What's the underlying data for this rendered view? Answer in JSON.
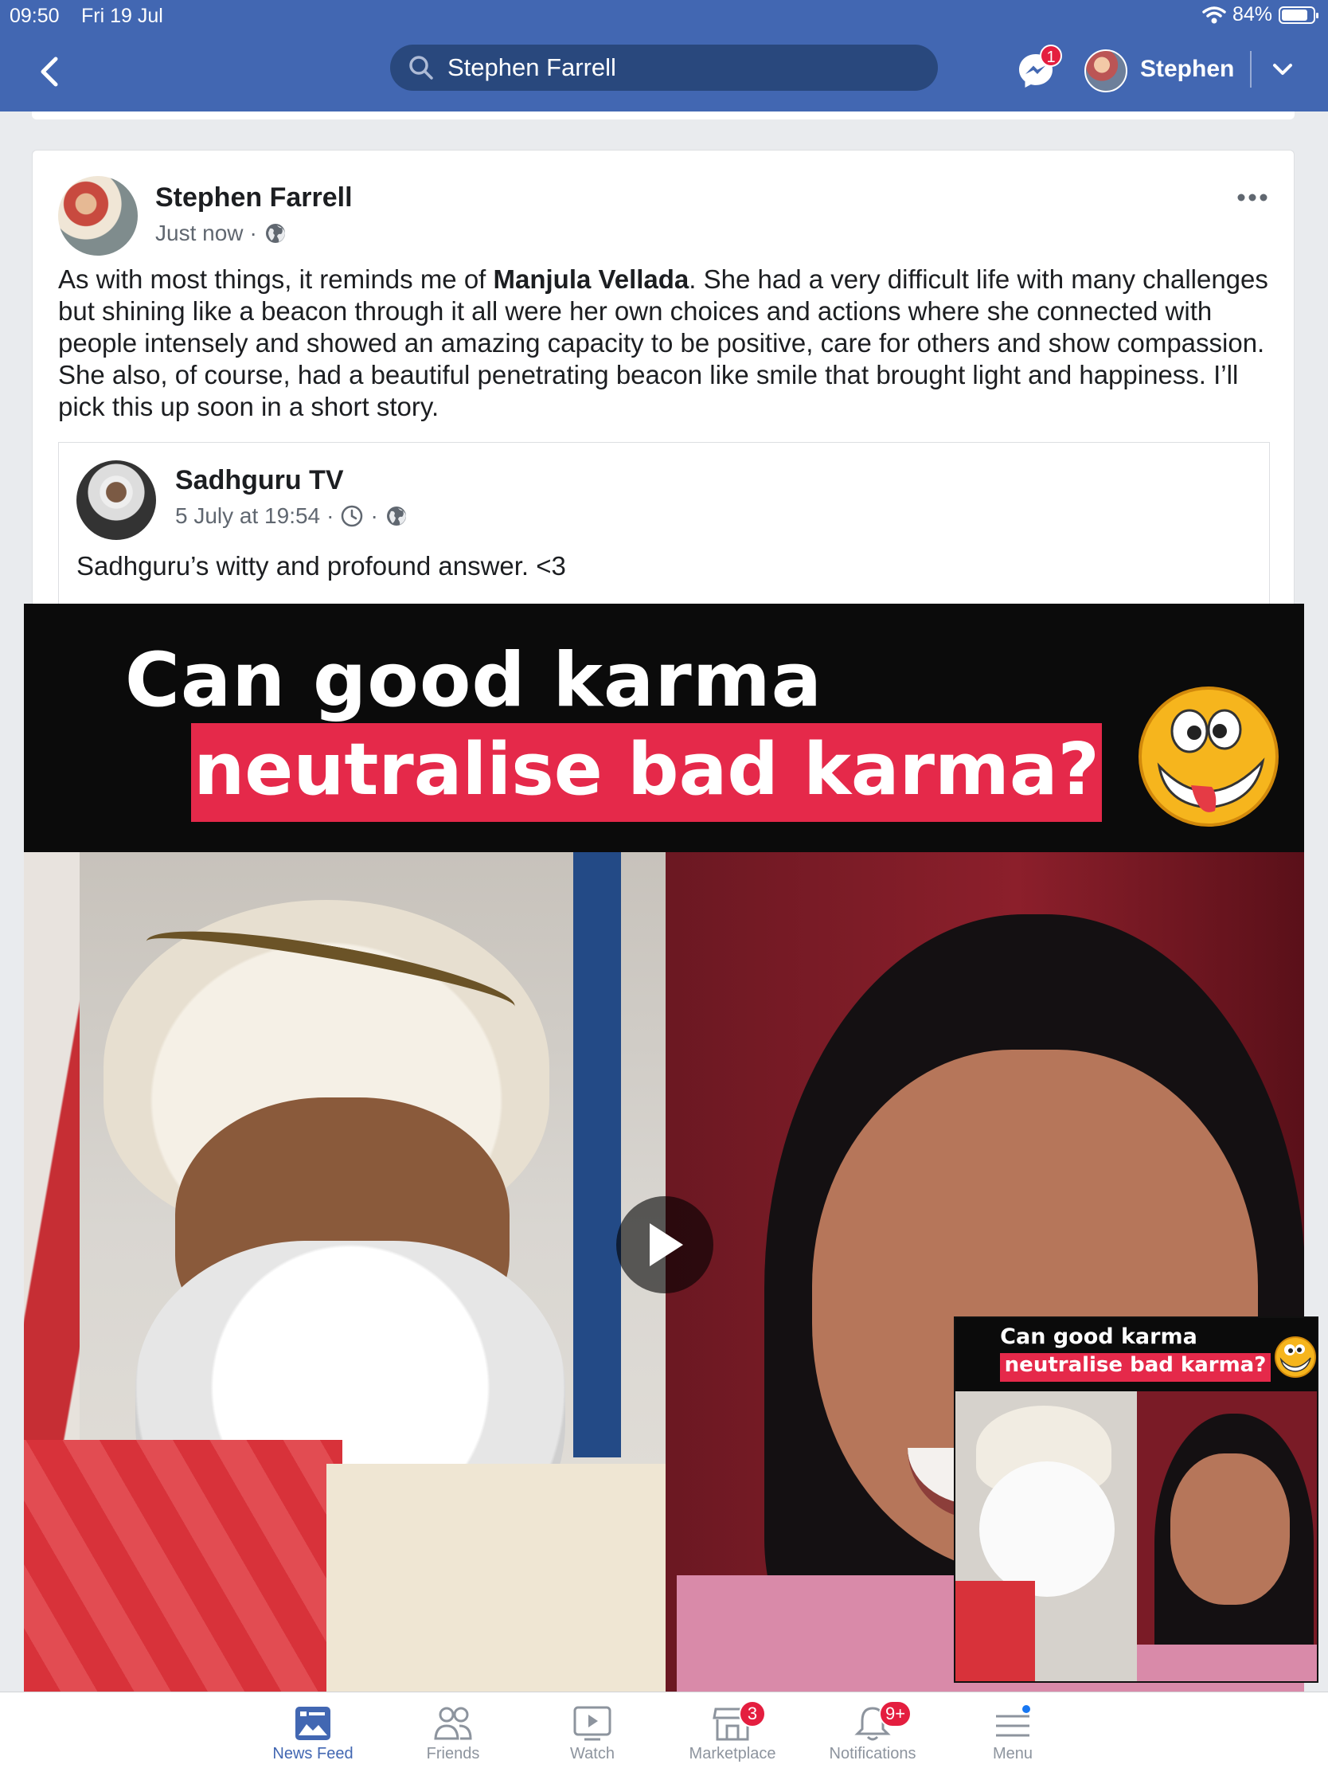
{
  "status_bar": {
    "time": "09:50",
    "date": "Fri 19 Jul",
    "battery": "84%",
    "battery_level": 0.84
  },
  "header": {
    "search_value": "Stephen Farrell",
    "messenger_badge": "1",
    "user_name": "Stephen"
  },
  "post": {
    "author": "Stephen Farrell",
    "time": "Just now",
    "text_before": "As with most things, it reminds me of ",
    "text_bold": "Manjula Vellada",
    "text_after": ". She had a very difficult life with many challenges but shining like a beacon through it all were her own choices and actions where she connected with people intensely and showed an amazing capacity to be positive, care for others and show compassion. She also, of course, had a beautiful penetrating beacon like smile that brought light and happiness. I’ll pick this up soon in a short story.",
    "shared": {
      "page_name": "Sadhguru TV",
      "time": "5 July at 19:54",
      "text": "Sadhguru’s witty and profound answer. <3",
      "video": {
        "title_line1": "Can good karma",
        "title_line2": "neutralise bad karma?"
      }
    }
  },
  "tabs": [
    {
      "label": "News Feed",
      "icon": "news-feed-icon",
      "active": true
    },
    {
      "label": "Friends",
      "icon": "friends-icon"
    },
    {
      "label": "Watch",
      "icon": "watch-icon"
    },
    {
      "label": "Marketplace",
      "icon": "marketplace-icon",
      "badge": "3"
    },
    {
      "label": "Notifications",
      "icon": "bell-icon",
      "badge": "9+"
    },
    {
      "label": "Menu",
      "icon": "menu-icon"
    }
  ],
  "colors": {
    "brand": "#4267b2",
    "badge": "#e41e3f",
    "title_red": "#e5294a"
  }
}
